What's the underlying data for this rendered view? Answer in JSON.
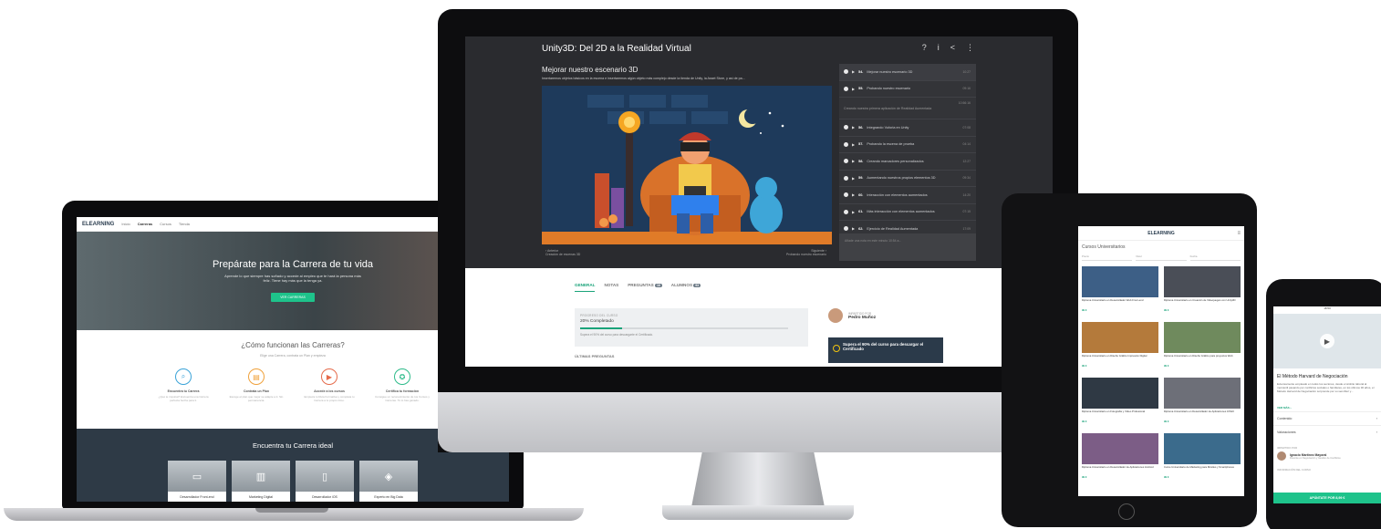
{
  "laptop": {
    "logo": "ELEARNING",
    "nav": [
      "Inicio",
      "Carreras",
      "Cursos",
      "Tienda"
    ],
    "hero_title": "Prepárate para la Carrera de tu vida",
    "hero_text": "Aprende lo que siempre has soñado y accede al empleo que te hará la persona más feliz. Tiene hay más que la tenga ya.",
    "hero_button": "VER CARRERAS",
    "how_title": "¿Cómo funcionan las Carreras?",
    "how_sub": "Elige una Carrera, contrata un Plan y empieza",
    "steps": [
      {
        "title": "Encuentra tu Carrera",
        "desc": "¿Qué te impulsa? Encuentra una Carrera perfecta hecha para ti.",
        "color": "#3aa3d8",
        "icon": "search-icon"
      },
      {
        "title": "Contrata un Plan",
        "desc": "Escoge el plan que mejor se adapte a ti. Sin permanencia.",
        "color": "#f0a13a",
        "icon": "plan-icon"
      },
      {
        "title": "Accede a los cursos",
        "desc": "Empieza tu Ruta Formativa y completa tu Carrera a tu propio ritmo.",
        "color": "#e56b4b",
        "icon": "play-icon"
      },
      {
        "title": "Certifica tu formación",
        "desc": "Consigue un reconocimiento de tus Cursos y Carreras. Tú lo has ganado.",
        "color": "#2dbb8a",
        "icon": "certificate-icon"
      }
    ],
    "find_title": "Encuentra tu Carrera ideal",
    "cards": [
      {
        "label": "Desarrollador Front-end",
        "icon": "laptop-icon"
      },
      {
        "label": "Marketing Digital",
        "icon": "chart-icon"
      },
      {
        "label": "Desarrollador iOS",
        "icon": "phone-icon"
      },
      {
        "label": "Experto en Big Data",
        "icon": "data-icon"
      }
    ]
  },
  "monitor": {
    "course_title": "Unity3D: Del 2D a la Realidad Virtual",
    "lesson_title": "Mejorar nuestro escenario 3D",
    "lesson_desc": "Insertaremos objetos básicos en la escena e insertaremos algún objeto más complejo desde la tienda de Unity, la Asset Store, y así de pa...",
    "prev": "‹ Anterior",
    "prev_sub": "Creación de escenas 3D",
    "next": "Siguiente ›",
    "next_sub": "Probando nuestro escenario",
    "lessons": [
      {
        "num": "54.",
        "title": "Mejorar nuestro escenario 3D",
        "dur": "10:27"
      },
      {
        "num": "55.",
        "title": "Probando nuestro escenario",
        "dur": "09:16"
      },
      {
        "num": "",
        "title": "Creando nuestra primera aplicación de Realidad Aumentada",
        "dur": "10:56:16"
      },
      {
        "num": "56.",
        "title": "Integrando Vuforia en Unity",
        "dur": "07:08"
      },
      {
        "num": "57.",
        "title": "Probando la escena de prueba",
        "dur": "04:14"
      },
      {
        "num": "58.",
        "title": "Creando marcadores personalizados",
        "dur": "12:27"
      },
      {
        "num": "59.",
        "title": "Aumentando nuestros propios elementos 3D",
        "dur": "09:34"
      },
      {
        "num": "60.",
        "title": "Interacción con elementos aumentados",
        "dur": "14:20"
      },
      {
        "num": "61.",
        "title": "Más interacción con elementos aumentados",
        "dur": "07:15"
      },
      {
        "num": "62.",
        "title": "Ejercicio de Realidad Aumentada",
        "dur": "17:09"
      }
    ],
    "note_placeholder": "Añade una nota en este minuto 10:54 a...",
    "tabs": [
      {
        "label": "GENERAL",
        "badge": ""
      },
      {
        "label": "NOTAS",
        "badge": ""
      },
      {
        "label": "PREGUNTAS",
        "badge": "16"
      },
      {
        "label": "ALUMNOS",
        "badge": "93"
      }
    ],
    "progress_label": "PROGRESO DEL CURSO",
    "progress_value": "20% Completado",
    "progress_pct": 20,
    "progress_hint": "Supera el 90% del curso para descargarte el Certificado.",
    "last_questions": "ÚLTIMAS PREGUNTAS",
    "instructor_label": "IMPARTIDO POR",
    "instructor_name": "Pedro Muñoz",
    "certificate": "Supera el 90% del curso para descargar el Certificado"
  },
  "tablet": {
    "logo": "ELEARNING",
    "title": "Cursos Universitarios",
    "filters": [
      "Precio",
      "Nivel",
      "Fecha"
    ],
    "courses": [
      {
        "title": "Diploma Universitario en Desarrollador Web Front-end",
        "meta": "99 €",
        "color": "#3d5f86"
      },
      {
        "title": "Diploma Universitario en Creación de Videojuegos con Unity3D",
        "meta": "99 €",
        "color": "#4a4e57"
      },
      {
        "title": "Diploma Universitario en Diseño Gráfico Impresión Digital",
        "meta": "99 €",
        "color": "#b47a3b"
      },
      {
        "title": "Diploma Universitario en Diseño Gráfico para proyectos Web",
        "meta": "99 €",
        "color": "#6f8a5d"
      },
      {
        "title": "Diploma Universitario en Fotografía y Vídeo Profesional",
        "meta": "99 €",
        "color": "#2f3944"
      },
      {
        "title": "Diploma Universitario en Desarrollador de Aplicaciones iOS10",
        "meta": "99 €",
        "color": "#6d6f78"
      },
      {
        "title": "Diploma Universitario en Desarrollador de Aplicaciones Android",
        "meta": "99 €",
        "color": "#7c5d86"
      },
      {
        "title": "Curso Universitario de Marketing para Móviles y Smartphones",
        "meta": "99 €",
        "color": "#3b6b8c"
      }
    ]
  },
  "phone": {
    "status": "18:50",
    "title": "El Método Harvard de Negociación",
    "desc": "Extensamente empleado en todos los sectores, desde el ámbito laboral al mercantil pasando por conflictos sociales o familiares, en los últimos 30 años, el Método Harvard de Negociación sorprende por su sencillez y...",
    "more": "VER MÁS ›",
    "rows": [
      "Contenido",
      "Valoraciones"
    ],
    "instructor_label": "IMPARTIDO POR",
    "instructor_name": "Ignacio Martínez Mayoral",
    "instructor_role": "Docente en Negociación y Gestión de Conflictos",
    "info_label": "INFORMACIÓN DEL CURSO",
    "cta": "APÚNTATE POR 8,99 €"
  }
}
